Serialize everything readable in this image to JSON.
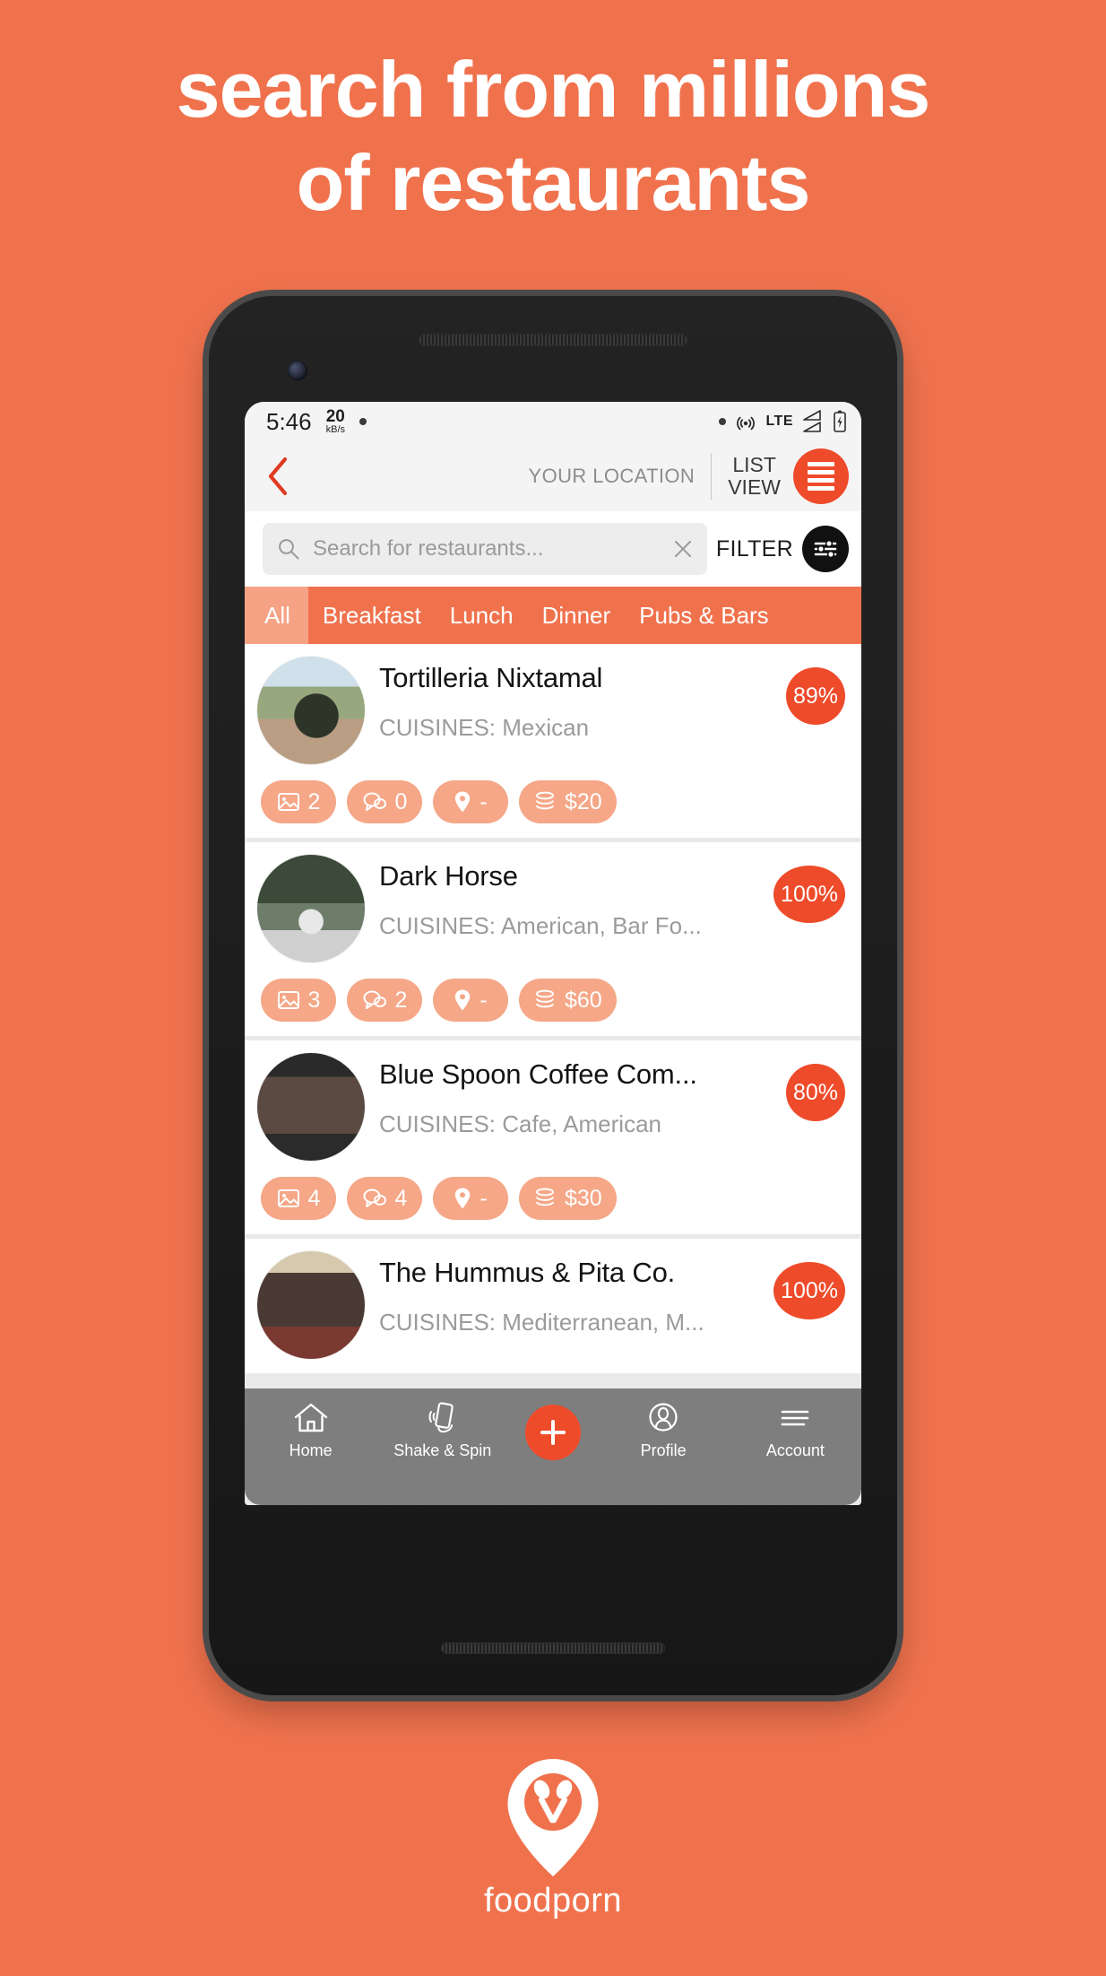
{
  "headline": {
    "line1": "search from millions",
    "line2": "of restaurants"
  },
  "brand": {
    "name": "foodporn",
    "logo_icon": "map-pin-crossed-spoons-icon",
    "accent_color": "#EE4B2B",
    "background_color": "#F0724D"
  },
  "phone": {
    "status_bar": {
      "time": "5:46",
      "net_speed_value": "20",
      "net_speed_unit": "kB/s",
      "notification_dot": "•",
      "network_type": "LTE",
      "icons": [
        "dot-icon",
        "hotspot-icon",
        "signal-bars-icon",
        "signal-bars-icon",
        "battery-charging-icon"
      ]
    },
    "app_bar": {
      "back_icon": "chevron-left-icon",
      "location_label": "YOUR LOCATION",
      "list_view_label": "LIST\nVIEW",
      "list_view_line1": "LIST",
      "list_view_line2": "VIEW",
      "list_view_icon": "list-icon"
    },
    "search": {
      "placeholder": "Search for restaurants...",
      "value": "",
      "search_icon": "search-icon",
      "clear_icon": "close-icon",
      "filter_label": "FILTER",
      "filter_icon": "sliders-icon"
    },
    "tabs": [
      {
        "label": "All",
        "active": true
      },
      {
        "label": "Breakfast",
        "active": false
      },
      {
        "label": "Lunch",
        "active": false
      },
      {
        "label": "Dinner",
        "active": false
      },
      {
        "label": "Pubs & Bars",
        "active": false
      }
    ],
    "restaurants": [
      {
        "name": "Tortilleria Nixtamal",
        "cuisines": "CUISINES: Mexican",
        "score": "89%",
        "photos": "2",
        "comments": "0",
        "distance": "-",
        "price": "$20"
      },
      {
        "name": "Dark Horse",
        "cuisines": "CUISINES: American, Bar Fo...",
        "score": "100%",
        "photos": "3",
        "comments": "2",
        "distance": "-",
        "price": "$60"
      },
      {
        "name": "Blue Spoon Coffee Com...",
        "cuisines": "CUISINES: Cafe, American",
        "score": "80%",
        "photos": "4",
        "comments": "4",
        "distance": "-",
        "price": "$30"
      },
      {
        "name": "The Hummus & Pita Co.",
        "cuisines": "CUISINES: Mediterranean, M...",
        "score": "100%",
        "photos": "",
        "comments": "",
        "distance": "",
        "price": ""
      }
    ],
    "bottom_nav": [
      {
        "label": "Home",
        "icon": "home-icon"
      },
      {
        "label": "Shake & Spin",
        "icon": "shake-phone-icon"
      },
      {
        "label": "",
        "icon": "plus-icon"
      },
      {
        "label": "Profile",
        "icon": "person-circle-icon"
      },
      {
        "label": "Account",
        "icon": "hamburger-menu-icon"
      }
    ]
  }
}
